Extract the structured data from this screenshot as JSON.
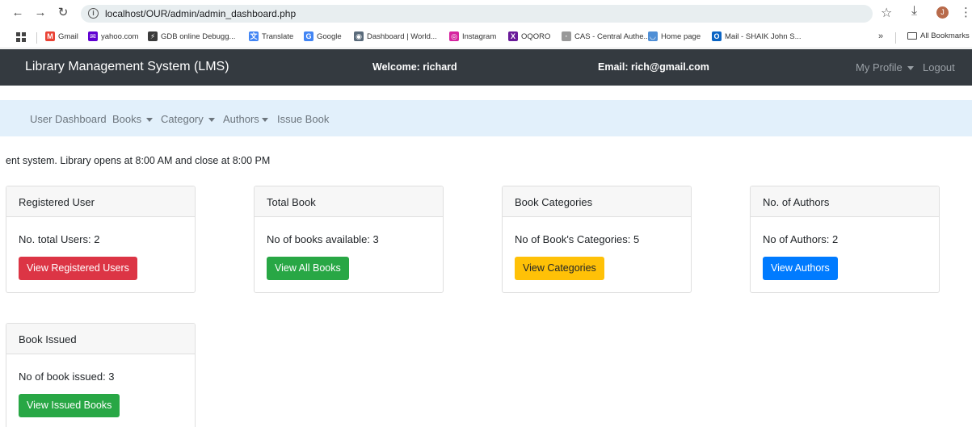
{
  "browser": {
    "url": "localhost/OUR/admin/admin_dashboard.php",
    "profile_initial": "J",
    "bookmarks": [
      {
        "label": "Gmail",
        "icon": "gmail-icon",
        "color": "#ea4335",
        "glyph": "M"
      },
      {
        "label": "yahoo.com",
        "icon": "yahoo-mail-icon",
        "color": "#6001d2",
        "glyph": "✉"
      },
      {
        "label": "GDB online Debugg...",
        "icon": "gdb-icon",
        "color": "#3b3b3b",
        "glyph": "⚡"
      },
      {
        "label": "Translate",
        "icon": "translate-icon",
        "color": "#4285f4",
        "glyph": "文"
      },
      {
        "label": "Google",
        "icon": "google-icon",
        "color": "#4285f4",
        "glyph": "G"
      },
      {
        "label": "Dashboard | World...",
        "icon": "dashboard-icon",
        "color": "#5a6b7b",
        "glyph": "◉"
      },
      {
        "label": "Instagram",
        "icon": "instagram-icon",
        "color": "#d6249f",
        "glyph": "◎"
      },
      {
        "label": "OQORO",
        "icon": "oqoro-icon",
        "color": "#6a1b9a",
        "glyph": "X"
      },
      {
        "label": "CAS - Central Authe...",
        "icon": "cas-icon",
        "color": "#999999",
        "glyph": "·"
      },
      {
        "label": "Home page",
        "icon": "home-page-icon",
        "color": "#4f8fd6",
        "glyph": "◡"
      },
      {
        "label": "Mail - SHAIK John S...",
        "icon": "outlook-icon",
        "color": "#0a64c4",
        "glyph": "O"
      }
    ],
    "all_bookmarks": "All Bookmarks",
    "more": "»"
  },
  "navbar": {
    "brand": "Library Management System (LMS)",
    "welcome": "Welcome: richard",
    "email": "Email: rich@gmail.com",
    "my_profile": "My Profile",
    "logout": "Logout"
  },
  "subnav": {
    "dashboard": "User Dashboard",
    "books": "Books",
    "category": "Category",
    "authors": "Authors",
    "issue_book": "Issue Book"
  },
  "notice": "ent system. Library opens at 8:00 AM and close at 8:00 PM",
  "cards": {
    "registered": {
      "title": "Registered User",
      "text": "No. total Users: 2",
      "button": "View Registered Users"
    },
    "books": {
      "title": "Total Book",
      "text": "No of books available: 3",
      "button": "View All Books"
    },
    "categories": {
      "title": "Book Categories",
      "text": "No of Book's Categories: 5",
      "button": "View Categories"
    },
    "authors": {
      "title": "No. of Authors",
      "text": "No of Authors: 2",
      "button": "View Authors"
    },
    "issued": {
      "title": "Book Issued",
      "text": "No of book issued: 3",
      "button": "View Issued Books"
    }
  },
  "colors": {
    "navbar_bg": "#343a40",
    "subnav_bg": "#e2f0fb",
    "danger": "#dc3545",
    "success": "#28a745",
    "warning": "#ffc107",
    "primary": "#007bff"
  }
}
